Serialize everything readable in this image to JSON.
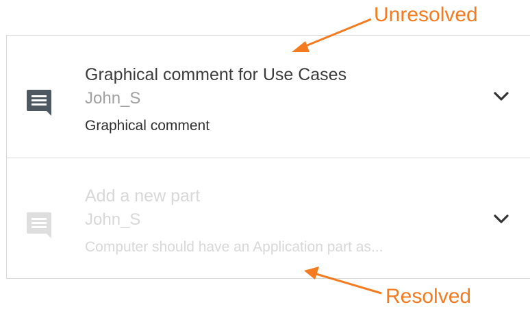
{
  "colors": {
    "annotation": "#f47b20",
    "unresolved_icon": "#4d5861",
    "resolved_icon": "#dedede",
    "chevron": "#333333",
    "divider": "#d9d9d9"
  },
  "annotations": {
    "unresolved_label": "Unresolved",
    "resolved_label": "Resolved"
  },
  "comments": [
    {
      "state": "unresolved",
      "icon": "comment-icon",
      "title": "Graphical comment for Use Cases",
      "author": "John_S",
      "text": "Graphical comment",
      "expand_icon": "chevron-down-icon"
    },
    {
      "state": "resolved",
      "icon": "comment-icon",
      "title": "Add a new part",
      "author": "John_S",
      "text": "Computer should have an Application part as...",
      "expand_icon": "chevron-down-icon"
    }
  ]
}
